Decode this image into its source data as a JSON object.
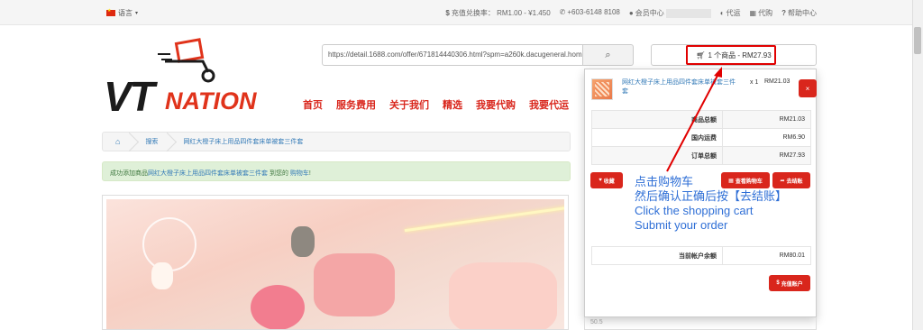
{
  "topbar": {
    "language": "语言",
    "exchange_rate_label": "充值兑换率：",
    "exchange_rate_value": "RM1.00 - ¥1.450",
    "phone": "+603-6148 8108",
    "member_center": "会员中心",
    "agent": "代运",
    "proxy_purchase": "代购",
    "help_center": "帮助中心"
  },
  "logo": {
    "vt": "VT",
    "nation": "NATION"
  },
  "search": {
    "url_value": "https://detail.1688.com/offer/671814440306.html?spm=a260k.dacugeneral.home2019rec.4.6633436",
    "button_icon": "search-icon"
  },
  "nav": {
    "items": [
      "首页",
      "服务费用",
      "关于我们",
      "精选",
      "我要代购",
      "我要代运"
    ]
  },
  "breadcrumb": {
    "home_icon": "home-icon",
    "search": "搜索",
    "current": "网红大橙子床上用品四件套床单被套三件套"
  },
  "alert": {
    "prefix": "成功添加商品",
    "product": "网红大橙子床上用品四件套床单被套三件套",
    "middle": " 到您的 ",
    "cart_link": "购物车",
    "suffix": "!"
  },
  "cart": {
    "button_label": "1 个商品 - RM27.93",
    "item": {
      "name": "网红大橙子床上用品四件套床单被套三件套",
      "qty": "x 1",
      "price": "RM21.03",
      "remove": "×"
    },
    "totals": [
      {
        "label": "商品总额",
        "value": "RM21.03"
      },
      {
        "label": "国内运费",
        "value": "RM6.90"
      },
      {
        "label": "订单总额",
        "value": "RM27.93"
      }
    ],
    "collect_button": "收藏",
    "view_cart_button": "查看购物车",
    "checkout_button": "去结账",
    "balance_label": "当前帐户余额",
    "balance_value": "RM80.01",
    "topup_button": "充值账户"
  },
  "annotation": {
    "line1": "点击购物车",
    "line2": "然后确认正确后按【去结账】",
    "line3": "Click the shopping cart",
    "line4": "Submit your order"
  },
  "below_row": "50.5",
  "colors": {
    "brand_red": "#d9261c",
    "link_blue": "#337ab7",
    "annotation_blue": "#2f6fd6",
    "alert_green_bg": "#dff0d8"
  }
}
